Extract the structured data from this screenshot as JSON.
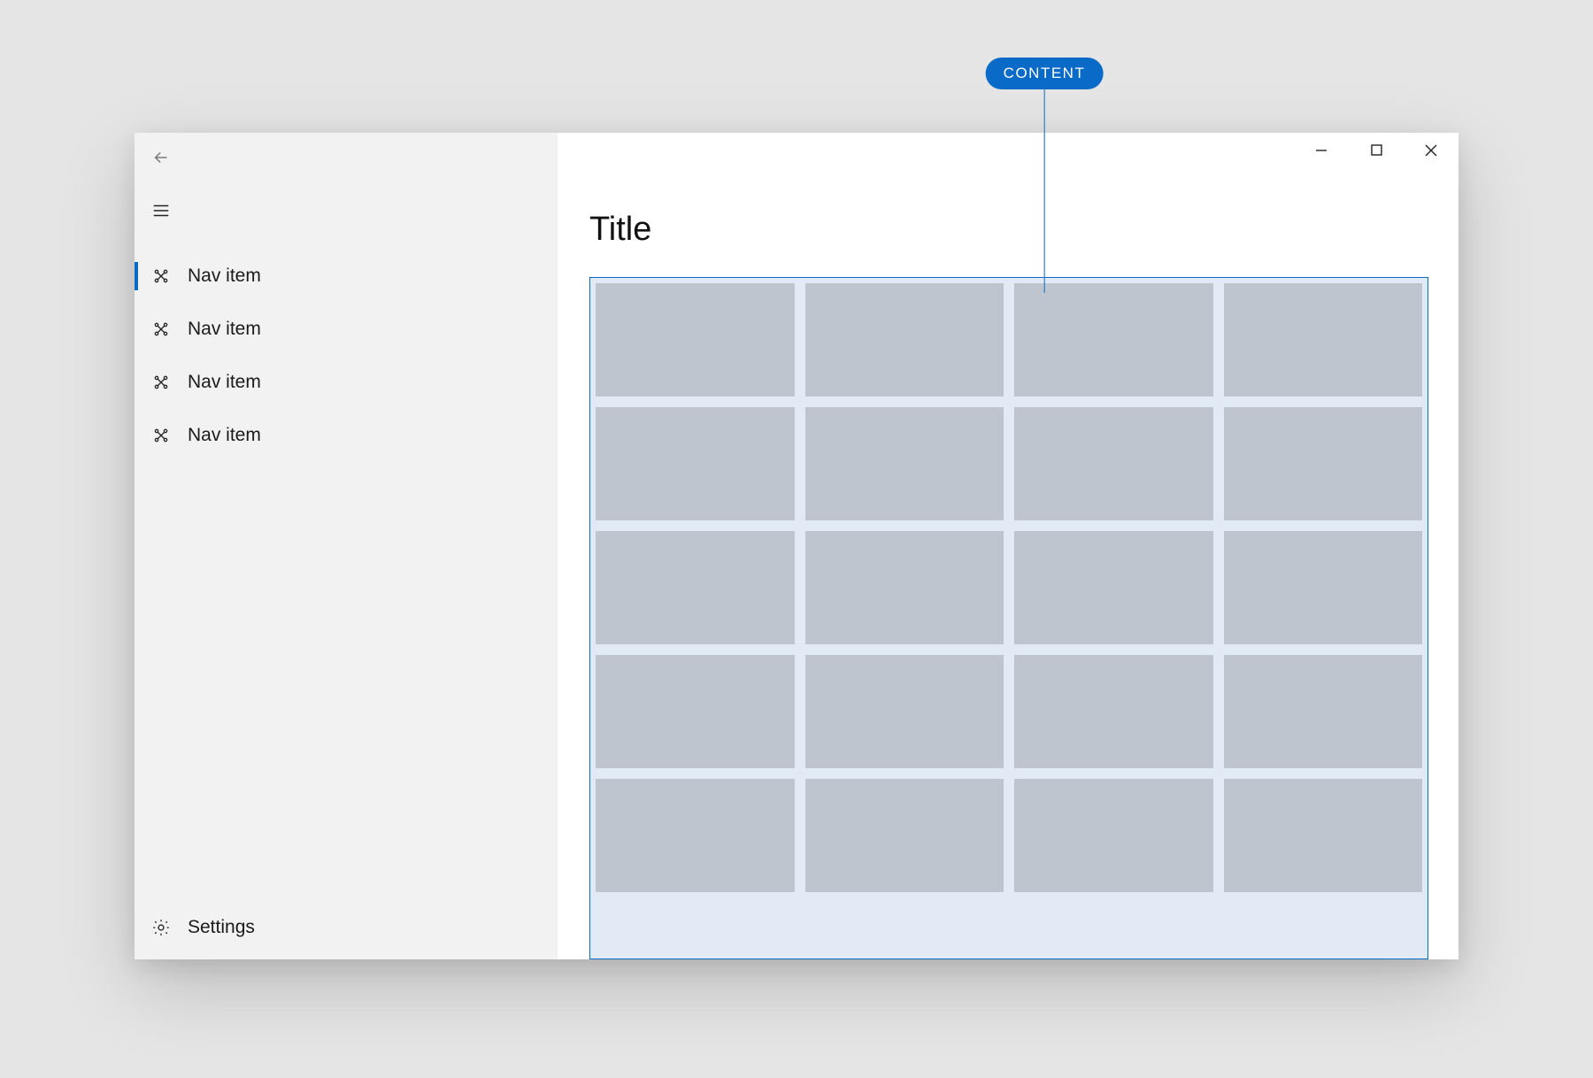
{
  "annotation": {
    "label": "CONTENT"
  },
  "sidebar": {
    "items": [
      {
        "label": "Nav item",
        "selected": true
      },
      {
        "label": "Nav item",
        "selected": false
      },
      {
        "label": "Nav item",
        "selected": false
      },
      {
        "label": "Nav item",
        "selected": false
      }
    ],
    "settings_label": "Settings"
  },
  "main": {
    "title": "Title"
  },
  "grid": {
    "columns": 4,
    "rows": 5
  },
  "colors": {
    "accent": "#0a6ac7",
    "sidebar_bg": "#f2f2f2",
    "tile": "#bec5ce",
    "content_bg": "#e2eaf5"
  }
}
